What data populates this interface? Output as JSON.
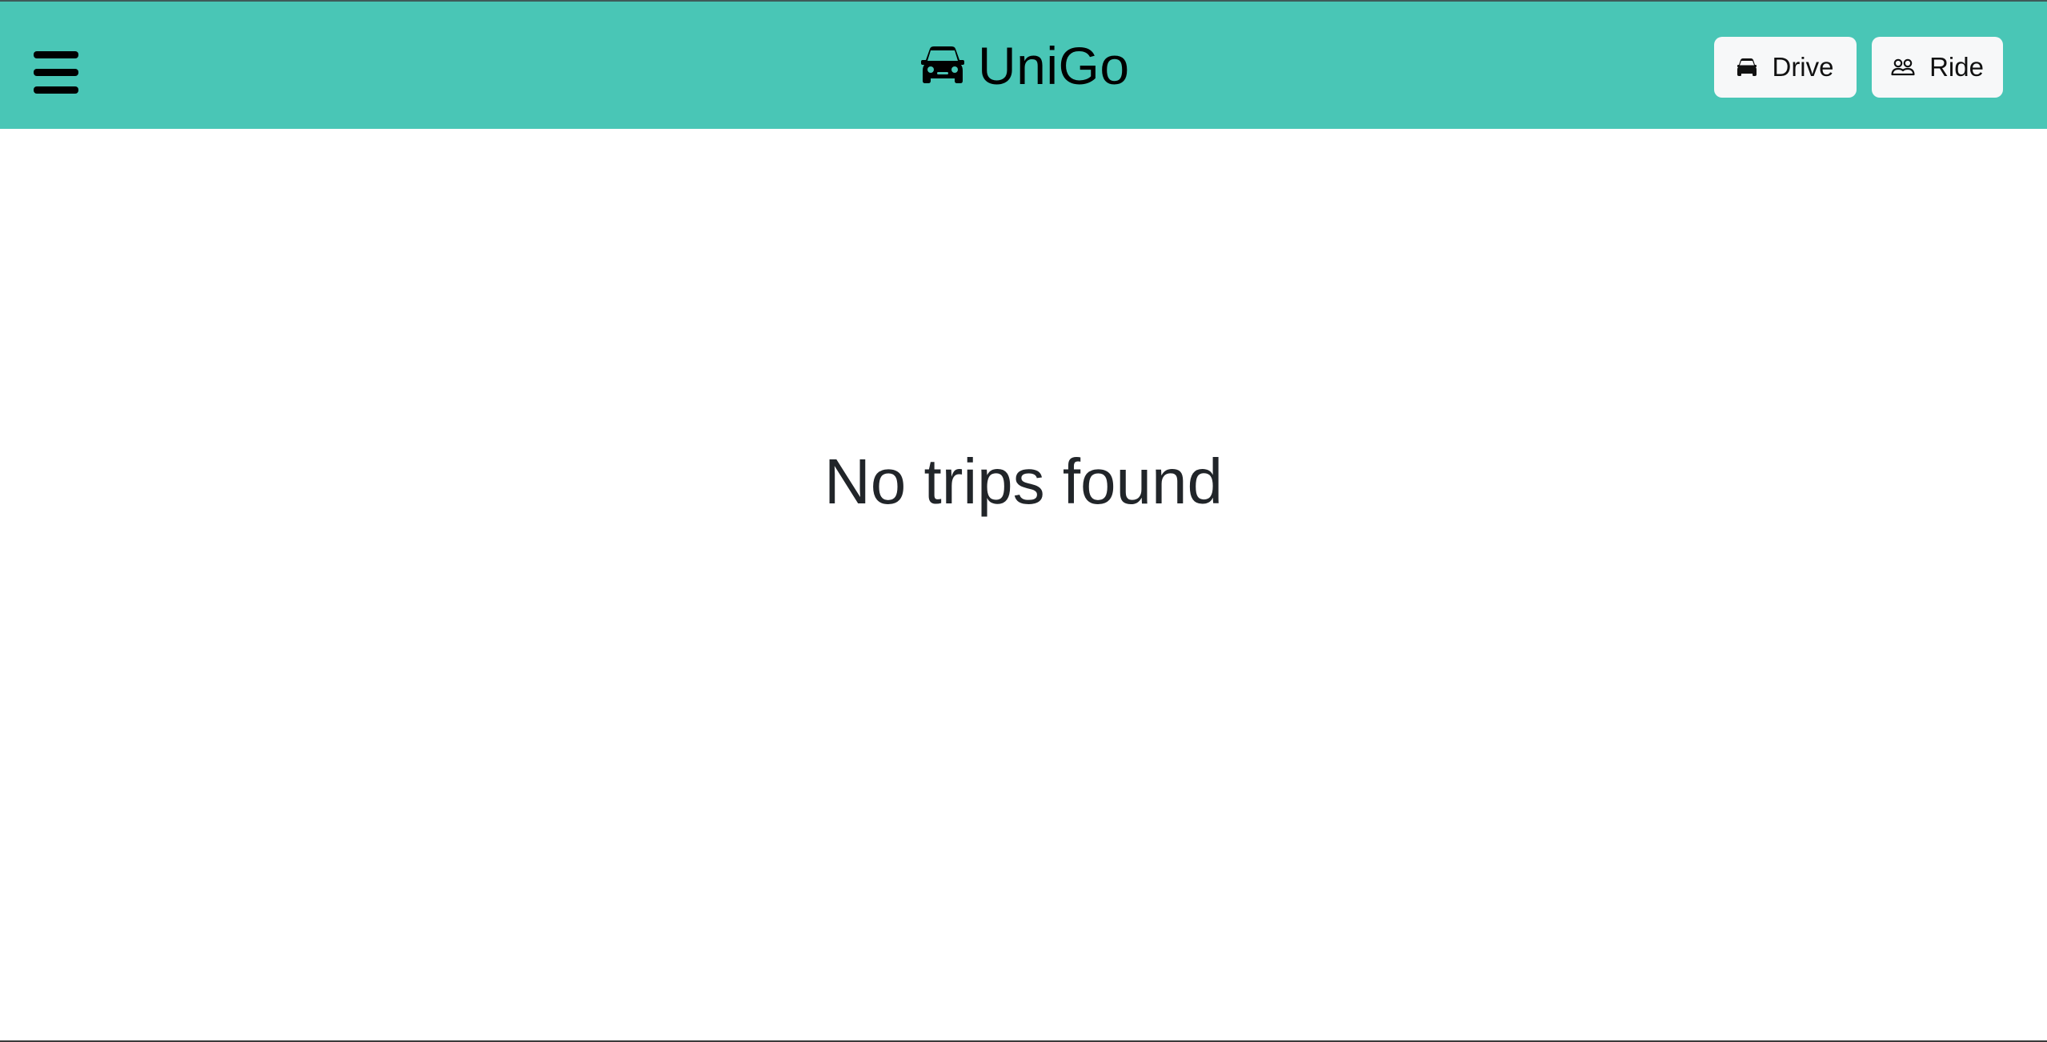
{
  "app": {
    "name": "UniGo"
  },
  "header": {
    "menu_icon": "hamburger-menu-icon",
    "brand_icon": "car-icon",
    "brand_color": "#49c6b6",
    "buttons": [
      {
        "label": "Drive",
        "icon": "car-icon"
      },
      {
        "label": "Ride",
        "icon": "people-icon"
      }
    ]
  },
  "main": {
    "empty_message": "No trips found",
    "text_color": "#212529"
  }
}
